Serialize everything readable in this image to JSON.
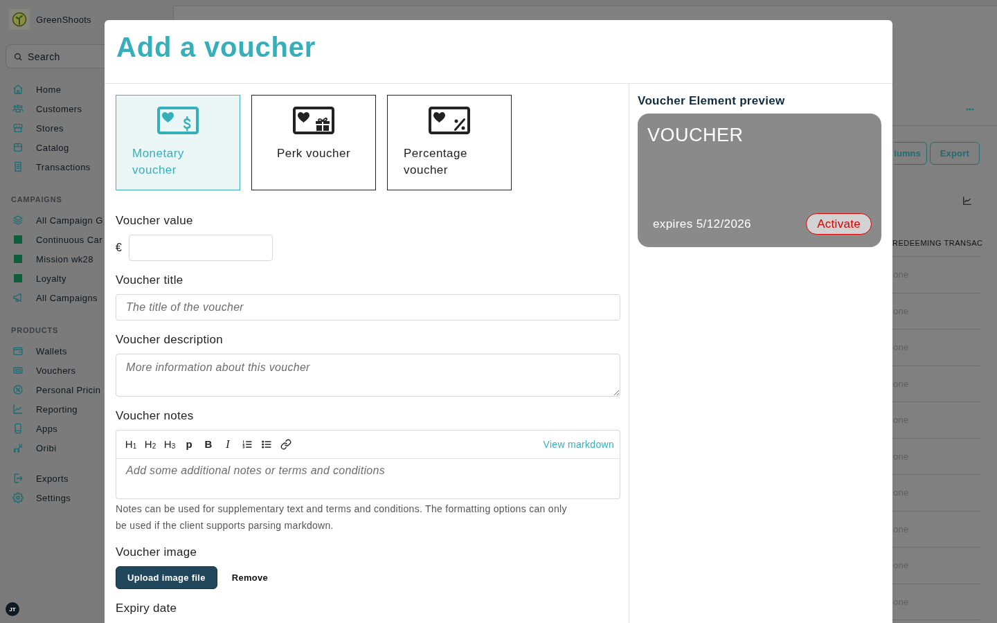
{
  "sidebar": {
    "brand": "GreenShoots",
    "search": {
      "placeholder": "Search"
    },
    "nav": [
      {
        "label": "Home"
      },
      {
        "label": "Customers"
      },
      {
        "label": "Stores"
      },
      {
        "label": "Catalog"
      },
      {
        "label": "Transactions"
      }
    ],
    "sections": [
      {
        "title": "CAMPAIGNS",
        "items": [
          {
            "kind": "link",
            "label": "All Campaign G"
          },
          {
            "kind": "campaign",
            "label": "Continuous Car",
            "color": "#0e5e3b"
          },
          {
            "kind": "campaign",
            "label": "Mission wk28",
            "color": "#0e5e3b"
          },
          {
            "kind": "campaign",
            "label": "Loyalty",
            "color": "#0e5e3b"
          },
          {
            "kind": "link",
            "label": "All Campaigns"
          }
        ]
      },
      {
        "title": "PRODUCTS",
        "items": [
          {
            "kind": "link",
            "label": "Wallets"
          },
          {
            "kind": "link",
            "label": "Vouchers"
          },
          {
            "kind": "link",
            "label": "Personal Pricin"
          },
          {
            "kind": "link",
            "label": "Reporting"
          },
          {
            "kind": "link",
            "label": "Apps"
          },
          {
            "kind": "link",
            "label": "Oribi"
          }
        ]
      }
    ],
    "footer_nav": [
      {
        "label": "Exports"
      },
      {
        "label": "Settings"
      }
    ],
    "user_initials": "JT"
  },
  "vouchers_page": {
    "buttons": [
      "lumns",
      "Export"
    ],
    "table": {
      "columns": [
        "REDEEMING TRANSAC"
      ],
      "rows": [
        [
          "one"
        ],
        [
          "one"
        ],
        [
          "one"
        ],
        [
          "one"
        ],
        [
          "one"
        ],
        [
          "one"
        ],
        [
          "one"
        ],
        [
          "one"
        ],
        [
          "one"
        ],
        [
          "one"
        ]
      ]
    }
  },
  "dialog": {
    "title": "Add a voucher",
    "voucher_types": [
      {
        "kind": "monetary",
        "label": "Monetary voucher",
        "selected": true
      },
      {
        "kind": "perk",
        "label": "Perk voucher",
        "selected": false
      },
      {
        "kind": "percentage",
        "label": "Percentage voucher",
        "selected": false
      }
    ],
    "value": {
      "label": "Voucher value",
      "currency": "€"
    },
    "title_field": {
      "label": "Voucher title",
      "placeholder": "The title of the voucher"
    },
    "description": {
      "label": "Voucher description",
      "placeholder": "More information about this voucher"
    },
    "notes": {
      "label": "Voucher notes",
      "toolbar": [
        {
          "kind": "heading",
          "label": "H$_{1}$"
        },
        {
          "kind": "heading",
          "label": "H$_{2}$"
        },
        {
          "kind": "heading",
          "label": "H$_{3}$"
        },
        {
          "kind": "paragraph",
          "label": "p"
        },
        {
          "kind": "bold",
          "label": "B"
        },
        {
          "kind": "italic",
          "label": "I"
        }
      ],
      "view_markdown": "View markdown",
      "placeholder": "Add some additional notes or terms and conditions",
      "help": "Notes can be used for supplementary text and terms and conditions. The formatting options can only be used if the client supports parsing markdown."
    },
    "image": {
      "label": "Voucher image",
      "upload": "Upload image file",
      "remove": "Remove"
    },
    "expiry": {
      "label": "Expiry date"
    },
    "preview": {
      "title": "Voucher Element preview",
      "heading": "VOUCHER",
      "expires": "expires 5/12/2026",
      "action": "Activate"
    }
  }
}
